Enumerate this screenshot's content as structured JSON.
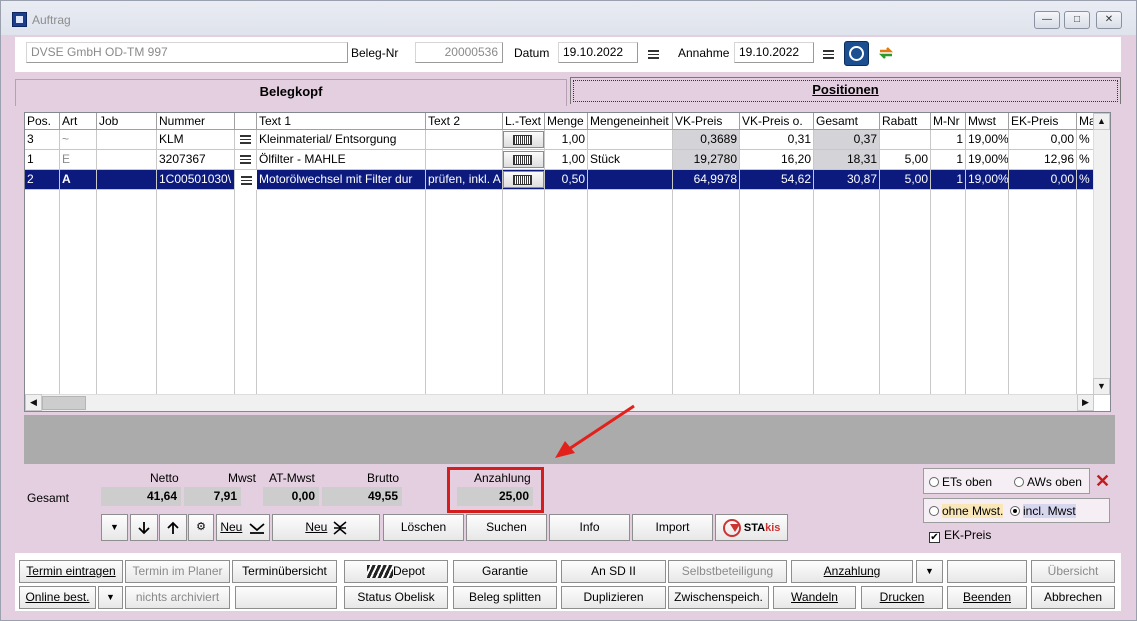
{
  "window": {
    "title": "Auftrag",
    "min": "—",
    "max": "□",
    "close": "✕"
  },
  "header": {
    "customer": "DVSE GmbH OD-TM 997",
    "beleg_label": "Beleg-Nr",
    "beleg_value": "20000536",
    "datum_label": "Datum",
    "datum_value": "19.10.2022",
    "annahme_label": "Annahme",
    "annahme_value": "19.10.2022"
  },
  "tabs": {
    "belegkopf": "Belegkopf",
    "positionen": "Positionen"
  },
  "grid": {
    "headers": [
      "Pos.",
      "Art",
      "Job",
      "Nummer",
      "",
      "Text 1",
      "Text 2",
      "L.-Text",
      "Menge",
      "Mengeneinheit",
      "VK-Preis",
      "VK-Preis o.",
      "Gesamt",
      "Rabatt",
      "M-Nr",
      "Mwst",
      "EK-Preis",
      "Ma"
    ],
    "rows": [
      {
        "pos": "3",
        "art": "~",
        "job": "",
        "nummer": "KLM",
        "text1": "Kleinmaterial/ Entsorgung",
        "text2": "",
        "menge": "1,00",
        "einheit": "",
        "vk": "0,3689",
        "vko": "0,31",
        "gesamt": "0,37",
        "rabatt": "",
        "mnr": "1",
        "mwst": "19,00%",
        "ek": "0,00",
        "ma": "%"
      },
      {
        "pos": "1",
        "art": "E",
        "job": "",
        "nummer": "3207367",
        "text1": "Ölfilter - MAHLE",
        "text2": "",
        "menge": "1,00",
        "einheit": "Stück",
        "vk": "19,2780",
        "vko": "16,20",
        "gesamt": "18,31",
        "rabatt": "5,00",
        "mnr": "1",
        "mwst": "19,00%",
        "ek": "12,96",
        "ma": "%"
      },
      {
        "pos": "2",
        "art": "A",
        "job": "",
        "nummer": "1C00501030\\",
        "text1": "Motorölwechsel mit Filter dur",
        "text2": "prüfen, inkl. A",
        "menge": "0,50",
        "einheit": "",
        "vk": "64,9978",
        "vko": "54,62",
        "gesamt": "30,87",
        "rabatt": "5,00",
        "mnr": "1",
        "mwst": "19,00%",
        "ek": "0,00",
        "ma": "%"
      }
    ]
  },
  "summary": {
    "gesamt_label": "Gesamt",
    "netto_label": "Netto",
    "netto": "41,64",
    "mwst_label": "Mwst",
    "mwst": "7,91",
    "atmwst_label": "AT-Mwst",
    "atmwst": "0,00",
    "brutto_label": "Brutto",
    "brutto": "49,55",
    "anzahlung_label": "Anzahlung",
    "anzahlung": "25,00"
  },
  "toolbar": {
    "neu1": "Neu",
    "neu2": "Neu",
    "loeschen": "Löschen",
    "suchen": "Suchen",
    "info": "Info",
    "import": "Import",
    "stakis_a": "STA",
    "stakis_b": "kis"
  },
  "options": {
    "ets_oben": "ETs oben",
    "aws_oben": "AWs oben",
    "ohne_mwst": "ohne Mwst.",
    "incl_mwst": "incl. Mwst",
    "ek_preis": "EK-Preis"
  },
  "bottom": {
    "row1": [
      "Termin eintragen",
      "Termin im Planer",
      "Terminübersicht",
      "Depot",
      "Garantie",
      "An SD II",
      "Selbstbeteiligung",
      "Anzahlung",
      "",
      "",
      "Übersicht"
    ],
    "row2": [
      "Online best.",
      "nichts archiviert",
      "",
      "Status Obelisk",
      "Beleg splitten",
      "Duplizieren",
      "Zwischenspeich.",
      "Wandeln",
      "Drucken",
      "Beenden",
      "Abbrechen"
    ]
  },
  "colors": {
    "accent": "#0c1a7d",
    "background": "#e4cfe0",
    "highlight": "#d41d1d"
  }
}
